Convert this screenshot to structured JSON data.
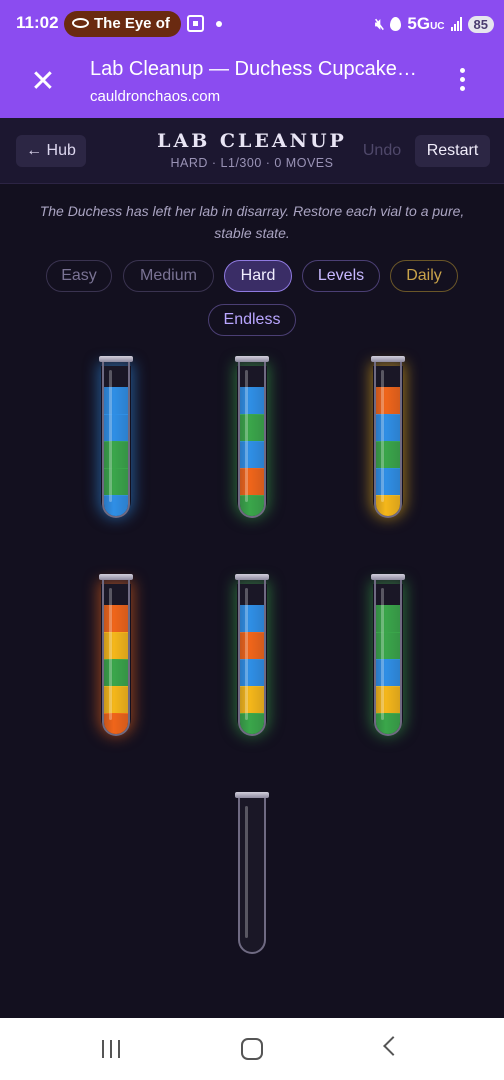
{
  "status_bar": {
    "time": "11:02",
    "notification_label": "The Eye of",
    "network": "5G",
    "network_sub": "UC",
    "battery": "85"
  },
  "browser": {
    "title": "Lab Cleanup — Duchess Cupcake…",
    "url": "cauldronchaos.com"
  },
  "header": {
    "hub_label": "← Hub",
    "title": "LAB CLEANUP",
    "subtitle": "HARD · L1/300 · 0 MOVES",
    "undo_label": "Undo",
    "restart_label": "Restart"
  },
  "description": "The Duchess has left her lab in disarray. Restore each vial to a pure, stable state.",
  "modes": [
    "Easy",
    "Medium",
    "Hard",
    "Levels",
    "Daily",
    "Endless"
  ],
  "selected_mode": "Hard",
  "colors": {
    "blue": "#2f8fe6",
    "green": "#3aa64a",
    "orange": "#f0651a",
    "yellow": "#f5b71a",
    "accent": "#8b4cf0"
  },
  "tubes": [
    {
      "name": "vial-1",
      "layers_top_to_bottom": [
        "empty",
        "blue",
        "blue",
        "green",
        "green",
        "blue"
      ]
    },
    {
      "name": "vial-2",
      "layers_top_to_bottom": [
        "empty",
        "blue",
        "green",
        "blue",
        "orange",
        "green"
      ]
    },
    {
      "name": "vial-3",
      "layers_top_to_bottom": [
        "empty",
        "orange",
        "blue",
        "green",
        "blue",
        "yellow"
      ]
    },
    {
      "name": "vial-4",
      "layers_top_to_bottom": [
        "empty",
        "orange",
        "yellow",
        "green",
        "yellow",
        "orange"
      ]
    },
    {
      "name": "vial-5",
      "layers_top_to_bottom": [
        "empty",
        "blue",
        "orange",
        "blue",
        "yellow",
        "green"
      ]
    },
    {
      "name": "vial-6",
      "layers_top_to_bottom": [
        "empty",
        "green",
        "green",
        "blue",
        "yellow",
        "green"
      ]
    },
    {
      "name": "vial-7",
      "layers_top_to_bottom": [
        "empty",
        "empty",
        "empty",
        "empty",
        "empty",
        "empty"
      ]
    }
  ]
}
